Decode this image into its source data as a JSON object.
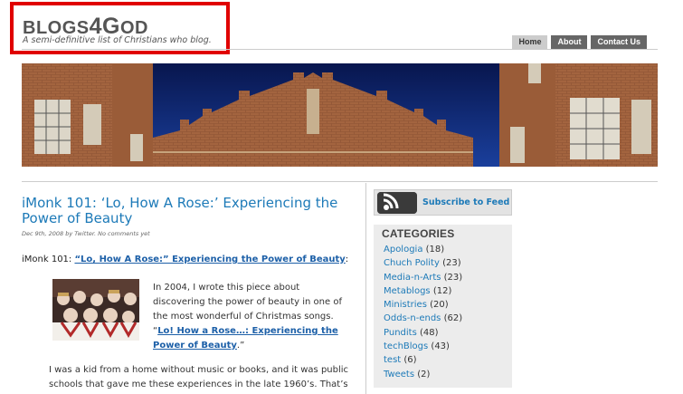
{
  "header": {
    "site_title_prefix": "BLOGS",
    "site_title_number": "4",
    "site_title_g": "G",
    "site_title_suffix": "OD",
    "tagline": "A semi-definitive list of Christians who blog.",
    "nav": [
      {
        "label": "Home",
        "active": true
      },
      {
        "label": "About",
        "active": false
      },
      {
        "label": "Contact Us",
        "active": false
      }
    ]
  },
  "post": {
    "title": "iMonk 101: ‘Lo, How A Rose:’ Experiencing the Power of Beauty",
    "meta": "Dec 9th, 2008 by Twitter. No comments yet",
    "intro_prefix": "iMonk 101: ",
    "intro_link": "“Lo, How A Rose:” Experiencing the Power of Beauty",
    "intro_suffix": ":",
    "quote_text": "In 2004, I wrote this piece about discovering the power of beauty in one of the most wonderful of Christmas songs.",
    "quote_link_open": "“",
    "quote_link": "Lo! How a Rose…: Experiencing the Power of Beauty",
    "quote_link_close": ".”",
    "body": "I was a kid from a home without music or books, and it was public schools that gave me these experiences in the late 1960’s. That’s"
  },
  "sidebar": {
    "feed_label": "Subscribe to Feed",
    "categories_title": "CATEGORIES",
    "categories": [
      {
        "name": "Apologia",
        "count": "(18)"
      },
      {
        "name": "Chuch Polity",
        "count": "(23)"
      },
      {
        "name": "Media-n-Arts",
        "count": "(23)"
      },
      {
        "name": "Metablogs",
        "count": "(12)"
      },
      {
        "name": "Ministries",
        "count": "(20)"
      },
      {
        "name": "Odds-n-ends",
        "count": "(62)"
      },
      {
        "name": "Pundits",
        "count": "(48)"
      },
      {
        "name": "techBlogs",
        "count": "(43)"
      },
      {
        "name": "test",
        "count": "(6)"
      },
      {
        "name": "Tweets",
        "count": "(2)"
      }
    ]
  },
  "colors": {
    "highlight_border": "#e00000",
    "link": "#1d7ab8",
    "nav_tab": "#666666",
    "nav_tab_active": "#cccccc",
    "sky": "#0a1b5a",
    "brick": "#a0603a"
  }
}
